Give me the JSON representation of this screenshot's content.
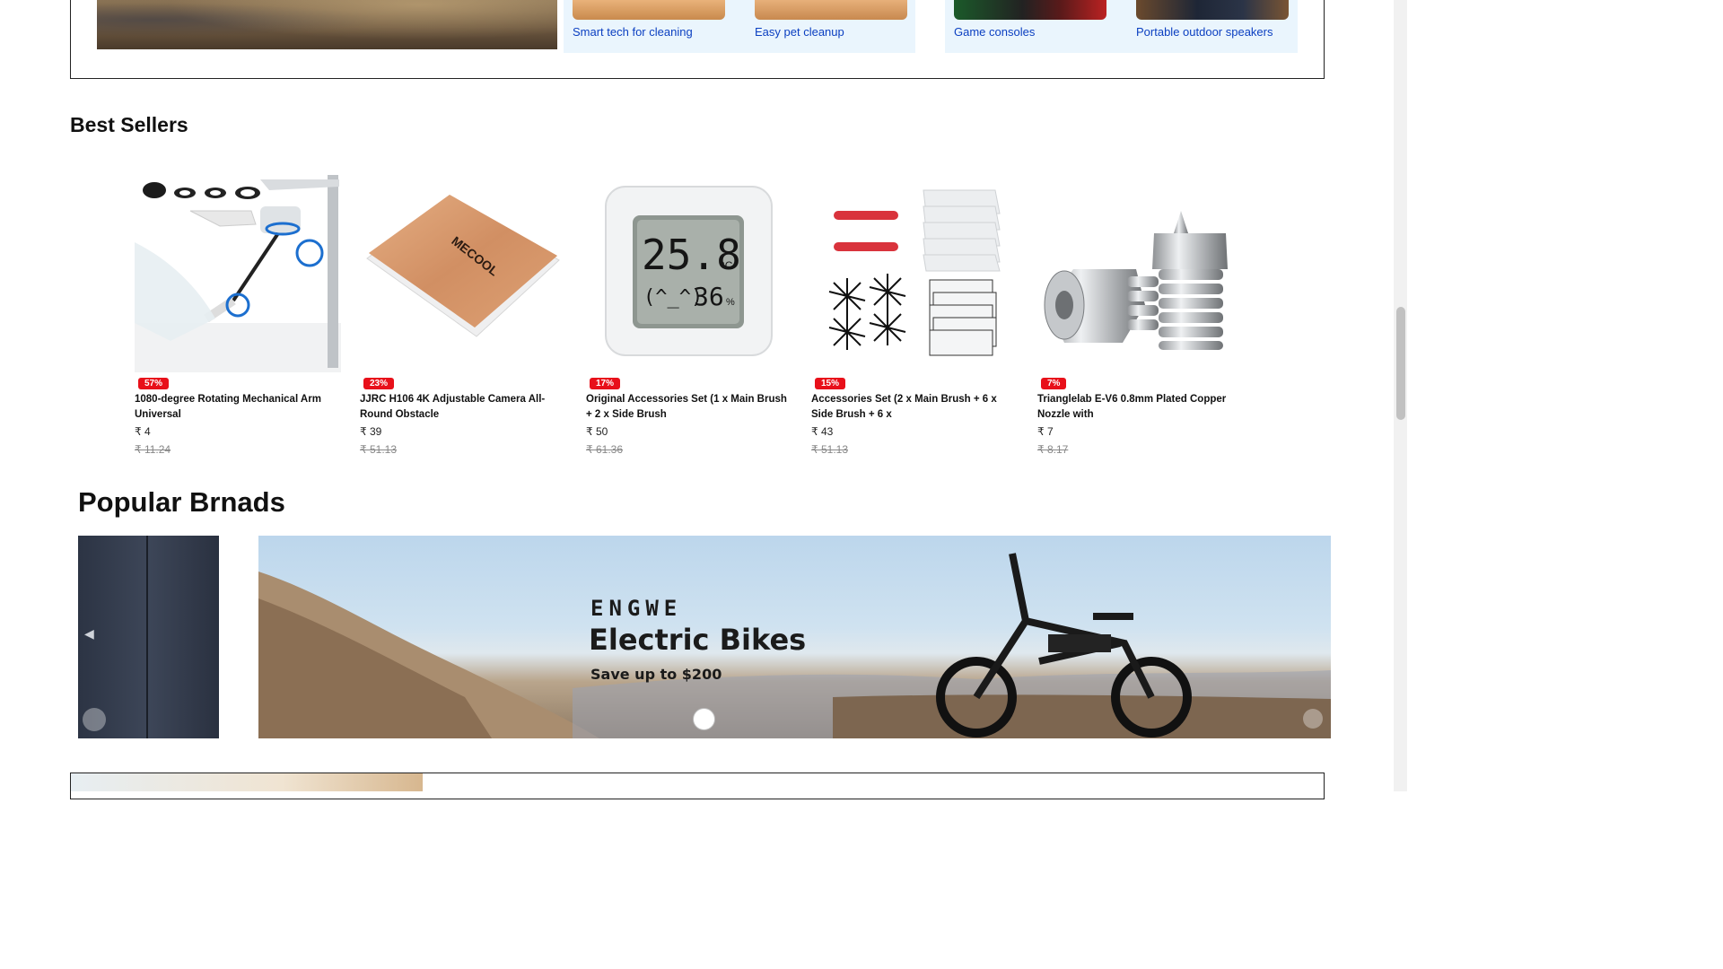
{
  "categories": {
    "items": [
      {
        "label": "Smart tech for cleaning"
      },
      {
        "label": "Easy pet cleanup"
      },
      {
        "label": "Game consoles"
      },
      {
        "label": "Portable outdoor speakers"
      }
    ]
  },
  "best_sellers": {
    "title": "Best Sellers",
    "products": [
      {
        "discount": "57%",
        "name": "1080-degree Rotating Mechanical Arm Universal",
        "price": "₹ 4",
        "old_price": "₹ 11.24",
        "image": "faucet-arm"
      },
      {
        "discount": "23%",
        "name": "JJRC H106 4K Adjustable Camera All-Round Obstacle",
        "price": "₹ 39",
        "old_price": "₹ 51.13",
        "image": "tv-box"
      },
      {
        "discount": "17%",
        "name": "Original Accessories Set (1 x Main Brush + 2 x Side Brush",
        "price": "₹ 50",
        "old_price": "₹ 61.36",
        "image": "thermometer"
      },
      {
        "discount": "15%",
        "name": "Accessories Set (2 x Main Brush + 6 x Side Brush + 6 x",
        "price": "₹ 43",
        "old_price": "₹ 51.13",
        "image": "vacuum-parts"
      },
      {
        "discount": "7%",
        "name": "Trianglelab E-V6 0.8mm Plated Copper Nozzle with",
        "price": "₹ 7",
        "old_price": "₹ 8.17",
        "image": "nozzle"
      }
    ]
  },
  "popular_brands": {
    "title": "Popular Brnads",
    "banner": {
      "logo": "ENGWE",
      "headline": "Electric Bikes",
      "subline": "Save up to $200"
    }
  },
  "thermometer_display": {
    "temp": "25.8",
    "unit": "°C",
    "face": "(^_^)",
    "humidity": "36",
    "humidity_unit": "%"
  },
  "tvbox_brand": "MECOOL",
  "icons": {
    "prev": "chevron-left-icon",
    "next": "chevron-right-icon"
  },
  "colors": {
    "link": "#0b3fc1",
    "badge": "#e8101a",
    "panel": "#eaf5fd"
  }
}
